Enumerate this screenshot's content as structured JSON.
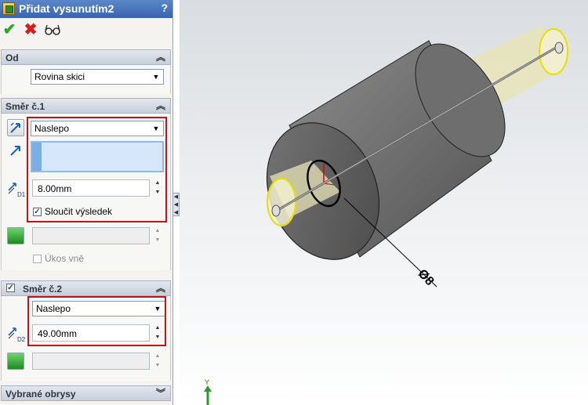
{
  "window": {
    "title": "Přidat vysunutím2",
    "help_label": "?"
  },
  "toolbar": {
    "ok_icon": "checkmark-icon",
    "cancel_icon": "cross-icon",
    "preview_icon": "glasses-icon"
  },
  "from_section": {
    "title": "Od",
    "start_condition": "Rovina skici"
  },
  "direction1": {
    "title": "Směr č.1",
    "end_condition": "Naslepo",
    "depth": "8.00mm",
    "merge_result_label": "Sloučit výsledek",
    "merge_result_checked": true,
    "draft_label": "Úkos vně",
    "draft_checked": false
  },
  "direction2": {
    "title": "Směr č.2",
    "enabled": true,
    "end_condition": "Naslepo",
    "depth": "49.00mm"
  },
  "selected_contours": {
    "title": "Vybrané obrysy"
  },
  "viewport": {
    "dimension_label": "Ø8",
    "axis_label": "Y",
    "highlight_color": "#c0161b",
    "preview_color": "#e9e6b0"
  }
}
